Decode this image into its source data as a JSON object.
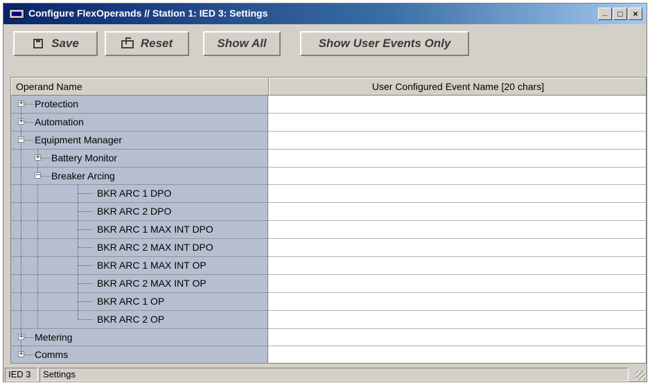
{
  "window": {
    "title": "Configure FlexOperands // Station 1: IED 3: Settings",
    "controls": {
      "minimize": "_",
      "maximize": "□",
      "close": "×"
    }
  },
  "toolbar": {
    "save_label": "Save",
    "reset_label": "Reset",
    "show_all_label": "Show All",
    "show_user_events_label": "Show User Events Only"
  },
  "table": {
    "headers": [
      "Operand Name",
      "User Configured Event Name [20 chars]"
    ],
    "rows": [
      {
        "label": "Protection",
        "level": 0,
        "expander": "+",
        "value": ""
      },
      {
        "label": "Automation",
        "level": 0,
        "expander": "+",
        "value": ""
      },
      {
        "label": "Equipment Manager",
        "level": 0,
        "expander": "-",
        "value": ""
      },
      {
        "label": "Battery Monitor",
        "level": 1,
        "expander": "+",
        "value": ""
      },
      {
        "label": "Breaker Arcing",
        "level": 1,
        "expander": "-",
        "value": ""
      },
      {
        "label": "BKR ARC 1 DPO",
        "level": 2,
        "expander": "",
        "value": ""
      },
      {
        "label": "BKR ARC 2 DPO",
        "level": 2,
        "expander": "",
        "value": ""
      },
      {
        "label": "BKR ARC 1 MAX INT DPO",
        "level": 2,
        "expander": "",
        "value": ""
      },
      {
        "label": "BKR ARC 2 MAX INT DPO",
        "level": 2,
        "expander": "",
        "value": ""
      },
      {
        "label": "BKR ARC 1 MAX INT OP",
        "level": 2,
        "expander": "",
        "value": ""
      },
      {
        "label": "BKR ARC 2 MAX INT OP",
        "level": 2,
        "expander": "",
        "value": ""
      },
      {
        "label": "BKR ARC 1 OP",
        "level": 2,
        "expander": "",
        "value": ""
      },
      {
        "label": "BKR ARC 2 OP",
        "level": 2,
        "expander": "",
        "value": ""
      },
      {
        "label": "Metering",
        "level": 0,
        "expander": "+",
        "value": ""
      },
      {
        "label": "Comms",
        "level": 0,
        "expander": "+",
        "value": ""
      }
    ]
  },
  "statusbar": {
    "device": "IED 3",
    "section": "Settings"
  },
  "colors": {
    "titlebar": "#0a246a",
    "operand_column": "#b6bfcf",
    "window": "#d4d0c8"
  },
  "icons": {
    "app": "app-window-icon",
    "save": "save-icon",
    "reset": "reset-icon"
  }
}
